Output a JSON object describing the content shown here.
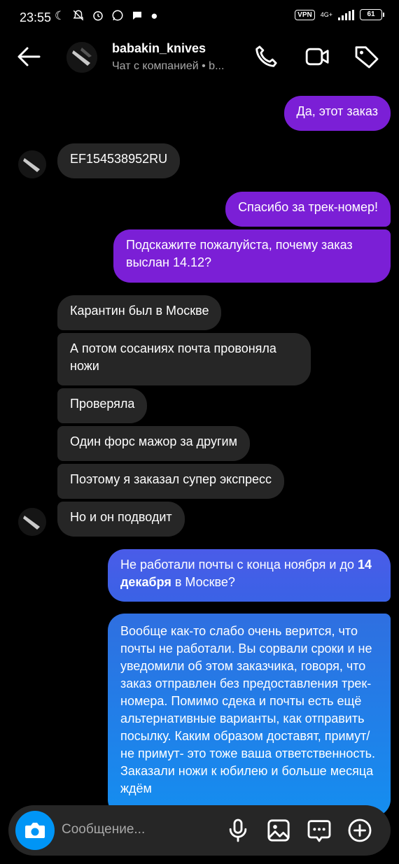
{
  "status_bar": {
    "time": "23:55",
    "vpn": "VPN",
    "network": "4G+",
    "battery": "61",
    "left_icons": [
      "moon-icon",
      "notifications-off-icon",
      "alarm-icon",
      "whatsapp-icon",
      "message-icon",
      "dot-icon"
    ]
  },
  "header": {
    "name": "babakin_knives",
    "subtitle": "Чат с компанией • b..."
  },
  "messages": [
    {
      "side": "out",
      "text": "Да, этот заказ"
    },
    {
      "side": "in",
      "text": "EF154538952RU"
    },
    {
      "side": "out",
      "text": "Спасибо за трек-номер!"
    },
    {
      "side": "out",
      "text": "Подскажите пожалуйста, почему заказ выслан 14.12?"
    },
    {
      "side": "in",
      "text": "Карантин был в Москве"
    },
    {
      "side": "in",
      "text": "А потом сосаниях почта провоняла ножи"
    },
    {
      "side": "in",
      "text": "Проверяла"
    },
    {
      "side": "in",
      "text": "Один форс мажор за другим"
    },
    {
      "side": "in",
      "text": "Поэтому я заказал супер экспресс"
    },
    {
      "side": "in",
      "text": "Но и он подводит"
    },
    {
      "side": "out",
      "text_before": "Не работали почты с конца ноября и до ",
      "bold": "14 декабря",
      "text_after": " в Москве?"
    },
    {
      "side": "out",
      "text": "Вообще как-то слабо очень верится, что почты не работали. Вы сорвали сроки и не уведомили об этом заказчика, говоря, что заказ отправлен без предоставления трек-номера. Помимо сдека и почты есть ещё альтернативные варианты, как отправить посылку. Каким образом доставят, примут/ не примут-  это тоже ваша ответственность. Заказали ножи к юбилею и больше месяца ждём"
    }
  ],
  "composer": {
    "placeholder": "Сообщение..."
  },
  "colors": {
    "background": "#000000",
    "incoming_bubble": "#262626",
    "outgoing_purple": "#7b1fd6",
    "outgoing_blue": "#2f6fe0",
    "camera_button": "#0095f6"
  }
}
